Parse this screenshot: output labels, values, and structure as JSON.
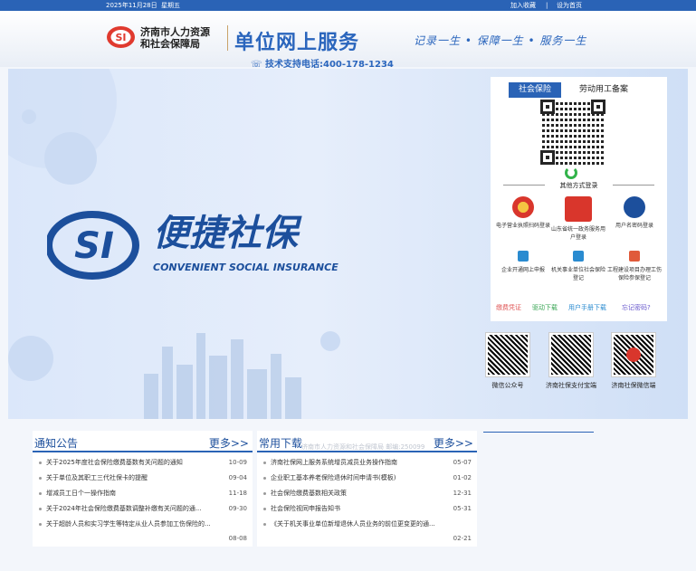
{
  "topbar": {
    "date": "2025年11月28日",
    "week": "星期五",
    "add_favorite": "加入收藏",
    "separator": "|",
    "set_home": "设为首页"
  },
  "header": {
    "bureau_line1": "济南市人力资源",
    "bureau_line2": "和社会保障局",
    "site_title": "单位网上服务",
    "slogan": "记录一生 • 保障一生 • 服务一生",
    "hotline": "技术支持电话:400-178-1234"
  },
  "hero": {
    "brand_cn": "便捷社保",
    "brand_en": "CONVENIENT SOCIAL INSURANCE"
  },
  "login": {
    "tabs": [
      {
        "label": "社会保险",
        "active": true
      },
      {
        "label": "劳动用工备案",
        "active": false
      }
    ],
    "other_methods": "其他方式登录",
    "methods": [
      {
        "label": "电子营业执照扫码登录",
        "icon": "business-license-icon"
      },
      {
        "label": "山东省统一政务服务用户登录",
        "icon": "shandong-gov-icon"
      },
      {
        "label": "用户名密码登录",
        "icon": "si-password-icon"
      },
      {
        "label": "企业开通网上申报",
        "icon": "enterprise-icon"
      },
      {
        "label": "机关事业单位社会保险登记",
        "icon": "institution-icon"
      },
      {
        "label": "工程建设项目办理工伤保险参保登记",
        "icon": "construction-icon"
      }
    ],
    "links": [
      {
        "label": "缴费凭证",
        "color": "#e05a5a"
      },
      {
        "label": "驱动下载",
        "color": "#3aa655"
      },
      {
        "label": "用户手册下载",
        "color": "#2a8bd0"
      },
      {
        "label": "忘记密码?",
        "color": "#6a5acd"
      }
    ]
  },
  "apps": [
    {
      "label": "微信公众号"
    },
    {
      "label": "济南社保支付宝端"
    },
    {
      "label": "济南社保微信端"
    }
  ],
  "notices": {
    "title": "通知公告",
    "more": "更多>>",
    "items": [
      {
        "title": "关于2025年度社会保险缴费基数有关问题的通知",
        "date": "10-09"
      },
      {
        "title": "关于单位及其职工三代社保卡的提醒",
        "date": "09-04"
      },
      {
        "title": "增减员工日个一操作指南",
        "date": "11-18"
      },
      {
        "title": "关于2024年社会保险缴费基数调整补缴有关问题的通...",
        "date": "09-30"
      },
      {
        "title": "关于超龄人员和实习学生等特定从业人员参加工伤保险的...",
        "date": ""
      },
      {
        "title": "",
        "date": "08-08"
      }
    ]
  },
  "downloads": {
    "title": "常用下载",
    "more": "更多>>",
    "faint_text": "济南市人力资源和社会保障局 邮编:250099",
    "items": [
      {
        "title": "济南社保网上服务系统增员减员业务操作指南",
        "date": "05-07"
      },
      {
        "title": "企业职工基本养老保险退休时间申请书(模板)",
        "date": "01-02"
      },
      {
        "title": "社会保险缴费基数相关政策",
        "date": "12-31"
      },
      {
        "title": "社会保险视同申报告知书",
        "date": "05-31"
      },
      {
        "title": "《关于机关事业单位新增退休人员业务的前位更变更的通...",
        "date": ""
      },
      {
        "title": "",
        "date": "02-21"
      }
    ]
  },
  "colors": {
    "brand_blue": "#2a63b6",
    "dark_blue": "#1c4f9c"
  }
}
